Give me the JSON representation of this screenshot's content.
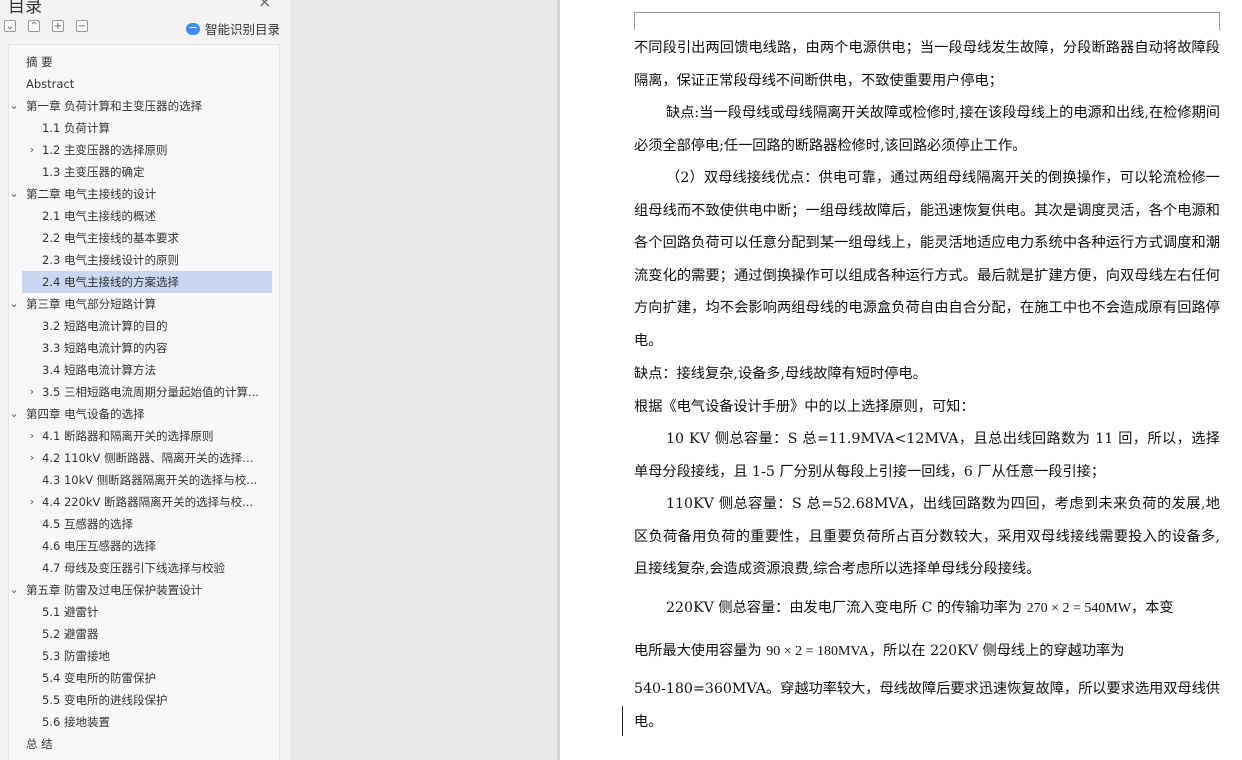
{
  "sidebar": {
    "title": "目录",
    "close_glyph": "×",
    "toolbar": [
      {
        "icon": "collapse-all-icon",
        "glyph": "⌄"
      },
      {
        "icon": "expand-all-icon",
        "glyph": "⌃"
      },
      {
        "icon": "add-icon",
        "glyph": "+"
      },
      {
        "icon": "remove-icon",
        "glyph": "−"
      }
    ],
    "smart_toc_label": "智能识别目录",
    "items": [
      {
        "label": "摘  要",
        "level": 0,
        "chevron": ""
      },
      {
        "label": "Abstract",
        "level": 0,
        "chevron": ""
      },
      {
        "label": "第一章  负荷计算和主变压器的选择",
        "level": 0,
        "chevron": "⌄"
      },
      {
        "label": "1.1 负荷计算",
        "level": 1,
        "chevron": ""
      },
      {
        "label": "1.2 主变压器的选择原则",
        "level": 1,
        "chevron": "›"
      },
      {
        "label": "1.3 主变压器的确定",
        "level": 1,
        "chevron": ""
      },
      {
        "label": "第二章  电气主接线的设计",
        "level": 0,
        "chevron": "⌄"
      },
      {
        "label": "2.1 电气主接线的概述",
        "level": 1,
        "chevron": ""
      },
      {
        "label": "2.2 电气主接线的基本要求",
        "level": 1,
        "chevron": ""
      },
      {
        "label": "2.3 电气主接线设计的原则",
        "level": 1,
        "chevron": ""
      },
      {
        "label": "2.4 电气主接线的方案选择",
        "level": 1,
        "chevron": "",
        "active": true
      },
      {
        "label": "第三章  电气部分短路计算",
        "level": 0,
        "chevron": "⌄"
      },
      {
        "label": "3.2 短路电流计算的目的",
        "level": 1,
        "chevron": ""
      },
      {
        "label": "3.3 短路电流计算的内容",
        "level": 1,
        "chevron": ""
      },
      {
        "label": "3.4 短路电流计算方法",
        "level": 1,
        "chevron": ""
      },
      {
        "label": "3.5 三相短路电流周期分量起始值的计算...",
        "level": 1,
        "chevron": "›"
      },
      {
        "label": "第四章  电气设备的选择",
        "level": 0,
        "chevron": "⌄"
      },
      {
        "label": "4.1 断路器和隔离开关的选择原则",
        "level": 1,
        "chevron": "›"
      },
      {
        "label": "4.2 110kV 侧断路器、隔离开关的选择与...",
        "level": 1,
        "chevron": "›"
      },
      {
        "label": "4.3 10kV 侧断路器隔离开关的选择与校...",
        "level": 1,
        "chevron": ""
      },
      {
        "label": "4.4 220kV 断路器隔离开关的选择与校...",
        "level": 1,
        "chevron": "›"
      },
      {
        "label": "4.5 互感器的选择",
        "level": 1,
        "chevron": ""
      },
      {
        "label": "4.6  电压互感器的选择",
        "level": 1,
        "chevron": ""
      },
      {
        "label": "4.7  母线及变压器引下线选择与校验",
        "level": 1,
        "chevron": ""
      },
      {
        "label": "第五章  防雷及过电压保护装置设计",
        "level": 0,
        "chevron": "⌄"
      },
      {
        "label": "5.1 避雷针",
        "level": 1,
        "chevron": ""
      },
      {
        "label": "5.2 避雷器",
        "level": 1,
        "chevron": ""
      },
      {
        "label": "5.3 防雷接地",
        "level": 1,
        "chevron": ""
      },
      {
        "label": "5.4 变电所的防雷保护",
        "level": 1,
        "chevron": ""
      },
      {
        "label": "5.5 变电所的进线段保护",
        "level": 1,
        "chevron": ""
      },
      {
        "label": "5.6 接地装置",
        "level": 1,
        "chevron": ""
      },
      {
        "label": "总  结",
        "level": 0,
        "chevron": ""
      }
    ]
  },
  "document": {
    "paragraphs": [
      {
        "text": "不同段引出两回馈电线路，由两个电源供电；当一段母线发生故障，分段断路器自动将故障段隔离，保证正常段母线不间断供电，不致使重要用户停电；",
        "indent": false
      },
      {
        "text": "缺点:当一段母线或母线隔离开关故障或检修时,接在该段母线上的电源和出线,在检修期间必须全部停电;任一回路的断路器检修时,该回路必须停止工作。",
        "indent": true
      },
      {
        "text": "（2）双母线接线优点：供电可靠，通过两组母线隔离开关的倒换操作，可以轮流检修一组母线而不致使供电中断；一组母线故障后，能迅速恢复供电。其次是调度灵活，各个电源和各个回路负荷可以任意分配到某一组母线上，能灵活地适应电力系统中各种运行方式调度和潮流变化的需要；通过倒换操作可以组成各种运行方式。最后就是扩建方便，向双母线左右任何方向扩建，均不会影响两组母线的电源盒负荷自由自合分配，在施工中也不会造成原有回路停电。",
        "indent": true
      },
      {
        "text": "缺点：接线复杂,设备多,母线故障有短时停电。",
        "indent": false
      },
      {
        "text": "根据《电气设备设计手册》中的以上选择原则，可知：",
        "indent": false
      },
      {
        "text": "10 KV 侧总容量：S 总=11.9MVA<12MVA，且总出线回路数为 11 回，所以，选择单母分段接线，且 1-5 厂分别从每段上引接一回线，6 厂从任意一段引接；",
        "indent": true
      },
      {
        "text": "110KV 侧总容量：S 总=52.68MVA，出线回路数为四回，考虑到未来负荷的发展,地区负荷备用负荷的重要性，且重要负荷所占百分数较大，采用双母线接线需要投入的设备多,且接线复杂,会造成资源浪费,综合考虑所以选择单母线分段接线。",
        "indent": true
      },
      {
        "text_a": "220KV 侧总容量：由发电厂流入变电所 C 的传输功率为 ",
        "math1": "270 × 2 = 540MW",
        "text_b": "，本变",
        "indent": true
      },
      {
        "text_a": "电所最大使用容量为 ",
        "math2": "90 × 2 = 180MVA",
        "text_b": "，所以在 220KV 侧母线上的穿越功率为",
        "indent": false
      },
      {
        "text": "540-180=360MVA。穿越功率较大，母线故障后要求迅速恢复故障，所以要求选用双母线供电。",
        "indent": false
      }
    ]
  }
}
